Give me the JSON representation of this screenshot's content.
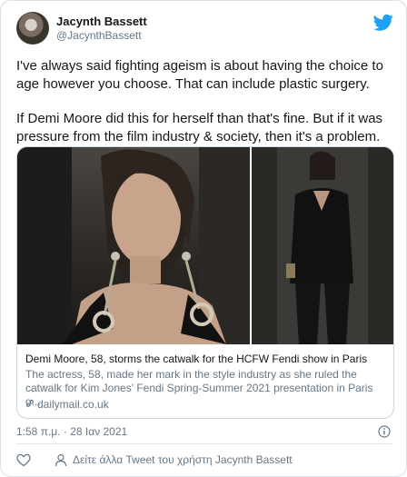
{
  "tweet": {
    "author_name": "Jacynth Bassett",
    "author_handle": "@JacynthBassett",
    "paragraphs": [
      "I've always said fighting ageism is about having the choice to age however you choose. That can include plastic surgery.",
      "If Demi Moore did this for herself than that's fine. But if it was pressure from the film industry & society, then it's a problem."
    ],
    "timestamp": "1:58 π.μ. · 28 Ιαν 2021",
    "view_user_tweets": "Δείτε άλλα Tweet του χρήστη Jacynth Bassett"
  },
  "link_card": {
    "title": "Demi Moore, 58, storms the catwalk for the HCFW Fendi show in Paris",
    "description": "The actress, 58, made her mark in the style industry as she ruled the catwalk for Kim Jones' Fendi Spring-Summer 2021 presentation in Paris o...",
    "domain": "dailymail.co.uk"
  },
  "colors": {
    "twitter_blue": "#1da1f2",
    "text_primary": "#14171a",
    "text_secondary": "#657786"
  },
  "icons": [
    "twitter-bird-icon",
    "link-icon",
    "info-icon",
    "heart-icon",
    "user-icon"
  ]
}
